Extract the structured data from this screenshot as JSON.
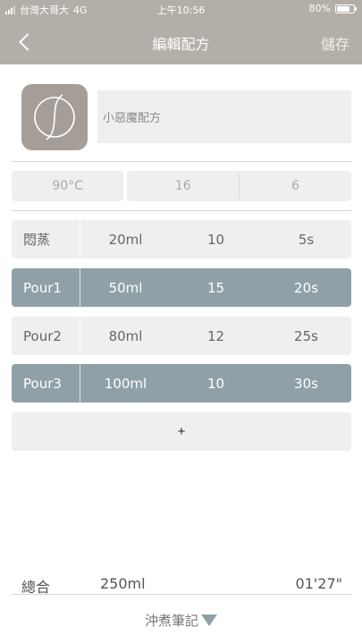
{
  "status_bar": {
    "carrier": "台灣大哥大",
    "network": "4G",
    "time": "上午10:56",
    "battery": "80%",
    "battery_level": 0.8
  },
  "nav": {
    "title": "編輯配方",
    "save_label": "儲存"
  },
  "recipe": {
    "name": "小惡魔配方"
  },
  "params": {
    "temperature": "90°C",
    "value_a": "16",
    "value_b": "6"
  },
  "steps": [
    {
      "label": "悶蒸",
      "volume": "20ml",
      "value": "10",
      "time": "5s"
    },
    {
      "label": "Pour1",
      "volume": "50ml",
      "value": "15",
      "time": "20s"
    },
    {
      "label": "Pour2",
      "volume": "80ml",
      "value": "12",
      "time": "25s"
    },
    {
      "label": "Pour3",
      "volume": "100ml",
      "value": "10",
      "time": "30s"
    }
  ],
  "add_label": "+",
  "total": {
    "label": "總合",
    "volume": "250ml",
    "time": "01'27\""
  },
  "notes_label": "沖煮筆記",
  "colors": {
    "header_bg": "#b4aea8",
    "accent_teal": "#8fa1a7",
    "field_bg": "#efefef"
  }
}
